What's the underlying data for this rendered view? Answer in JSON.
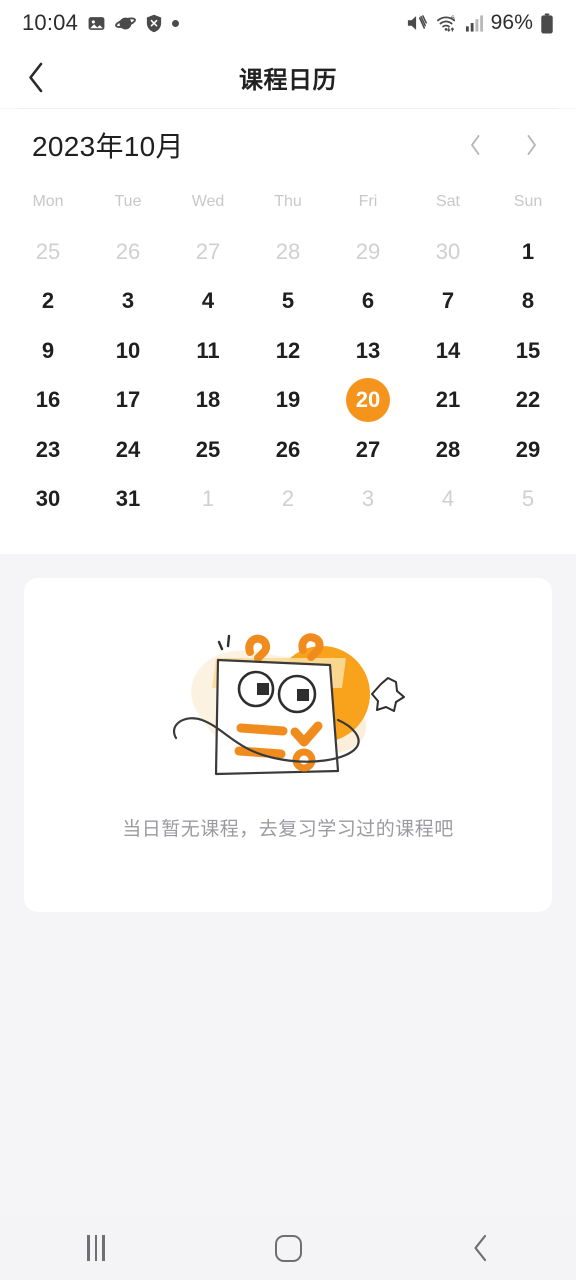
{
  "status_bar": {
    "time": "10:04",
    "left_icons": [
      "image-icon",
      "planet-icon",
      "shield-x-icon",
      "dot-icon"
    ],
    "battery_percent": "96%",
    "right_icons": [
      "mute-icon",
      "wifi-6-icon",
      "signal-bars-icon",
      "battery-icon"
    ]
  },
  "app_bar": {
    "back_icon": "chevron-left-icon",
    "title": "课程日历"
  },
  "calendar": {
    "month_label": "2023年10月",
    "prev_icon": "chevron-left-icon",
    "next_icon": "chevron-right-icon",
    "weekdays": [
      "Mon",
      "Tue",
      "Wed",
      "Thu",
      "Fri",
      "Sat",
      "Sun"
    ],
    "selected_day": 20,
    "accent_color": "#F5941D",
    "muted_color": "#CFCFD4",
    "weeks": [
      [
        {
          "d": "25",
          "muted": true
        },
        {
          "d": "26",
          "muted": true
        },
        {
          "d": "27",
          "muted": true
        },
        {
          "d": "28",
          "muted": true
        },
        {
          "d": "29",
          "muted": true
        },
        {
          "d": "30",
          "muted": true
        },
        {
          "d": "1",
          "muted": false
        }
      ],
      [
        {
          "d": "2",
          "muted": false
        },
        {
          "d": "3",
          "muted": false
        },
        {
          "d": "4",
          "muted": false
        },
        {
          "d": "5",
          "muted": false
        },
        {
          "d": "6",
          "muted": false
        },
        {
          "d": "7",
          "muted": false
        },
        {
          "d": "8",
          "muted": false
        }
      ],
      [
        {
          "d": "9",
          "muted": false
        },
        {
          "d": "10",
          "muted": false
        },
        {
          "d": "11",
          "muted": false
        },
        {
          "d": "12",
          "muted": false
        },
        {
          "d": "13",
          "muted": false
        },
        {
          "d": "14",
          "muted": false
        },
        {
          "d": "15",
          "muted": false
        }
      ],
      [
        {
          "d": "16",
          "muted": false
        },
        {
          "d": "17",
          "muted": false
        },
        {
          "d": "18",
          "muted": false
        },
        {
          "d": "19",
          "muted": false
        },
        {
          "d": "20",
          "muted": false,
          "selected": true
        },
        {
          "d": "21",
          "muted": false
        },
        {
          "d": "22",
          "muted": false
        }
      ],
      [
        {
          "d": "23",
          "muted": false
        },
        {
          "d": "24",
          "muted": false
        },
        {
          "d": "25",
          "muted": false
        },
        {
          "d": "26",
          "muted": false
        },
        {
          "d": "27",
          "muted": false
        },
        {
          "d": "28",
          "muted": false
        },
        {
          "d": "29",
          "muted": false
        }
      ],
      [
        {
          "d": "30",
          "muted": false
        },
        {
          "d": "31",
          "muted": false
        },
        {
          "d": "1",
          "muted": true
        },
        {
          "d": "2",
          "muted": true
        },
        {
          "d": "3",
          "muted": true
        },
        {
          "d": "4",
          "muted": true
        },
        {
          "d": "5",
          "muted": true
        }
      ]
    ]
  },
  "empty_state": {
    "illustration": "calendar-mascot-illustration",
    "message": "当日暂无课程，去复习学习过的课程吧"
  },
  "nav_bar": {
    "recents_icon": "recents-icon",
    "home_icon": "home-icon",
    "back_icon": "nav-back-icon"
  }
}
